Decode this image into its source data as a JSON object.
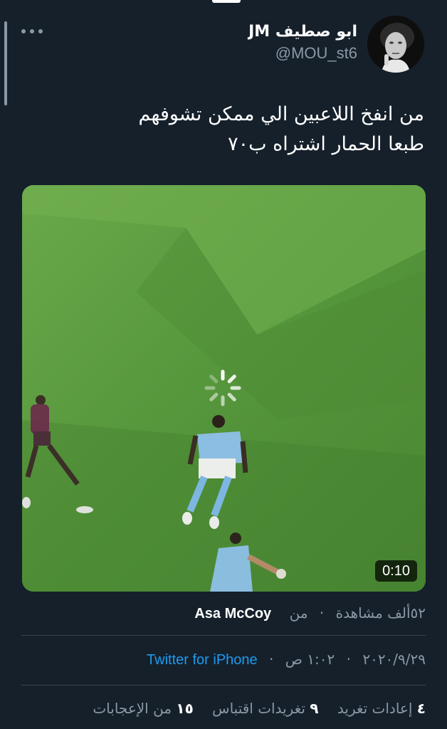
{
  "header": {
    "display_name": "ابو صطيف JM",
    "handle": "@MOU_st6",
    "more_icon": "more-horizontal-icon",
    "avatar_icon": "profile-photo"
  },
  "tweet": {
    "text_lines": [
      "من انفخ اللاعبين الي ممكن تشوفهم",
      "طبعا الحمار اشتراه ب٧٠"
    ]
  },
  "media": {
    "type": "video",
    "duration": "0:10",
    "loading_icon": "loading-spinner-icon"
  },
  "meta": {
    "views": "٥٢ألف مشاهدة",
    "from_label": "من",
    "source_user": "Asa McCoy",
    "separator": "·",
    "date": "٢٠٢٠/٩/٢٩",
    "time": "١:٠٢ ص",
    "client": "Twitter for iPhone"
  },
  "stats": {
    "retweets_count": "٤",
    "retweets_label": "إعادات تغريد",
    "quotes_count": "٩",
    "quotes_label": "تغريدات اقتباس",
    "likes_count": "١٥",
    "likes_label": "من الإعجابات"
  },
  "colors": {
    "background": "#15202b",
    "secondary_text": "#8b98a5",
    "link": "#1d9bf0",
    "divider": "#38444d",
    "pitch_green": "#4e8a34"
  }
}
